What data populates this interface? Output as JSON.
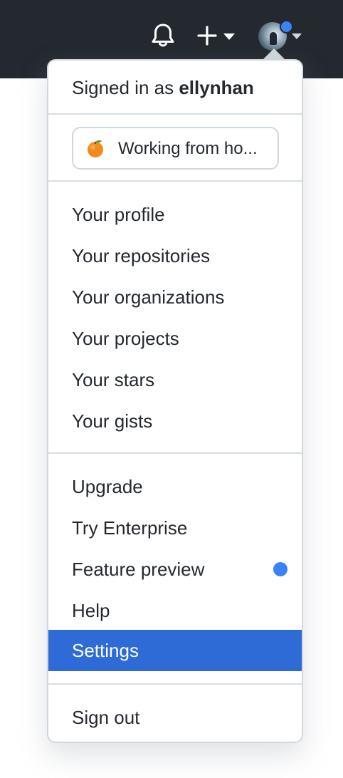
{
  "header": {
    "notifications_icon": "bell-icon",
    "create_icon": "plus-icon",
    "create_caret_icon": "caret-down-icon",
    "avatar_caret_icon": "caret-down-icon",
    "avatar_badge_color": "#3b82f6",
    "background_color": "#24292f"
  },
  "menu": {
    "signed_in_prefix": "Signed in as ",
    "username": "ellynhan",
    "status": {
      "emoji_icon": "tangerine-emoji-icon",
      "text": "Working from ho..."
    },
    "groups": [
      {
        "items": [
          {
            "label": "Your profile"
          },
          {
            "label": "Your repositories"
          },
          {
            "label": "Your organizations"
          },
          {
            "label": "Your projects"
          },
          {
            "label": "Your stars"
          },
          {
            "label": "Your gists"
          }
        ]
      },
      {
        "items": [
          {
            "label": "Upgrade"
          },
          {
            "label": "Try Enterprise"
          },
          {
            "label": "Feature preview",
            "badge": "blue-dot"
          },
          {
            "label": "Help"
          },
          {
            "label": "Settings",
            "active": true
          }
        ]
      },
      {
        "items": [
          {
            "label": "Sign out"
          }
        ]
      }
    ],
    "active_color": "#2f6bd6"
  }
}
